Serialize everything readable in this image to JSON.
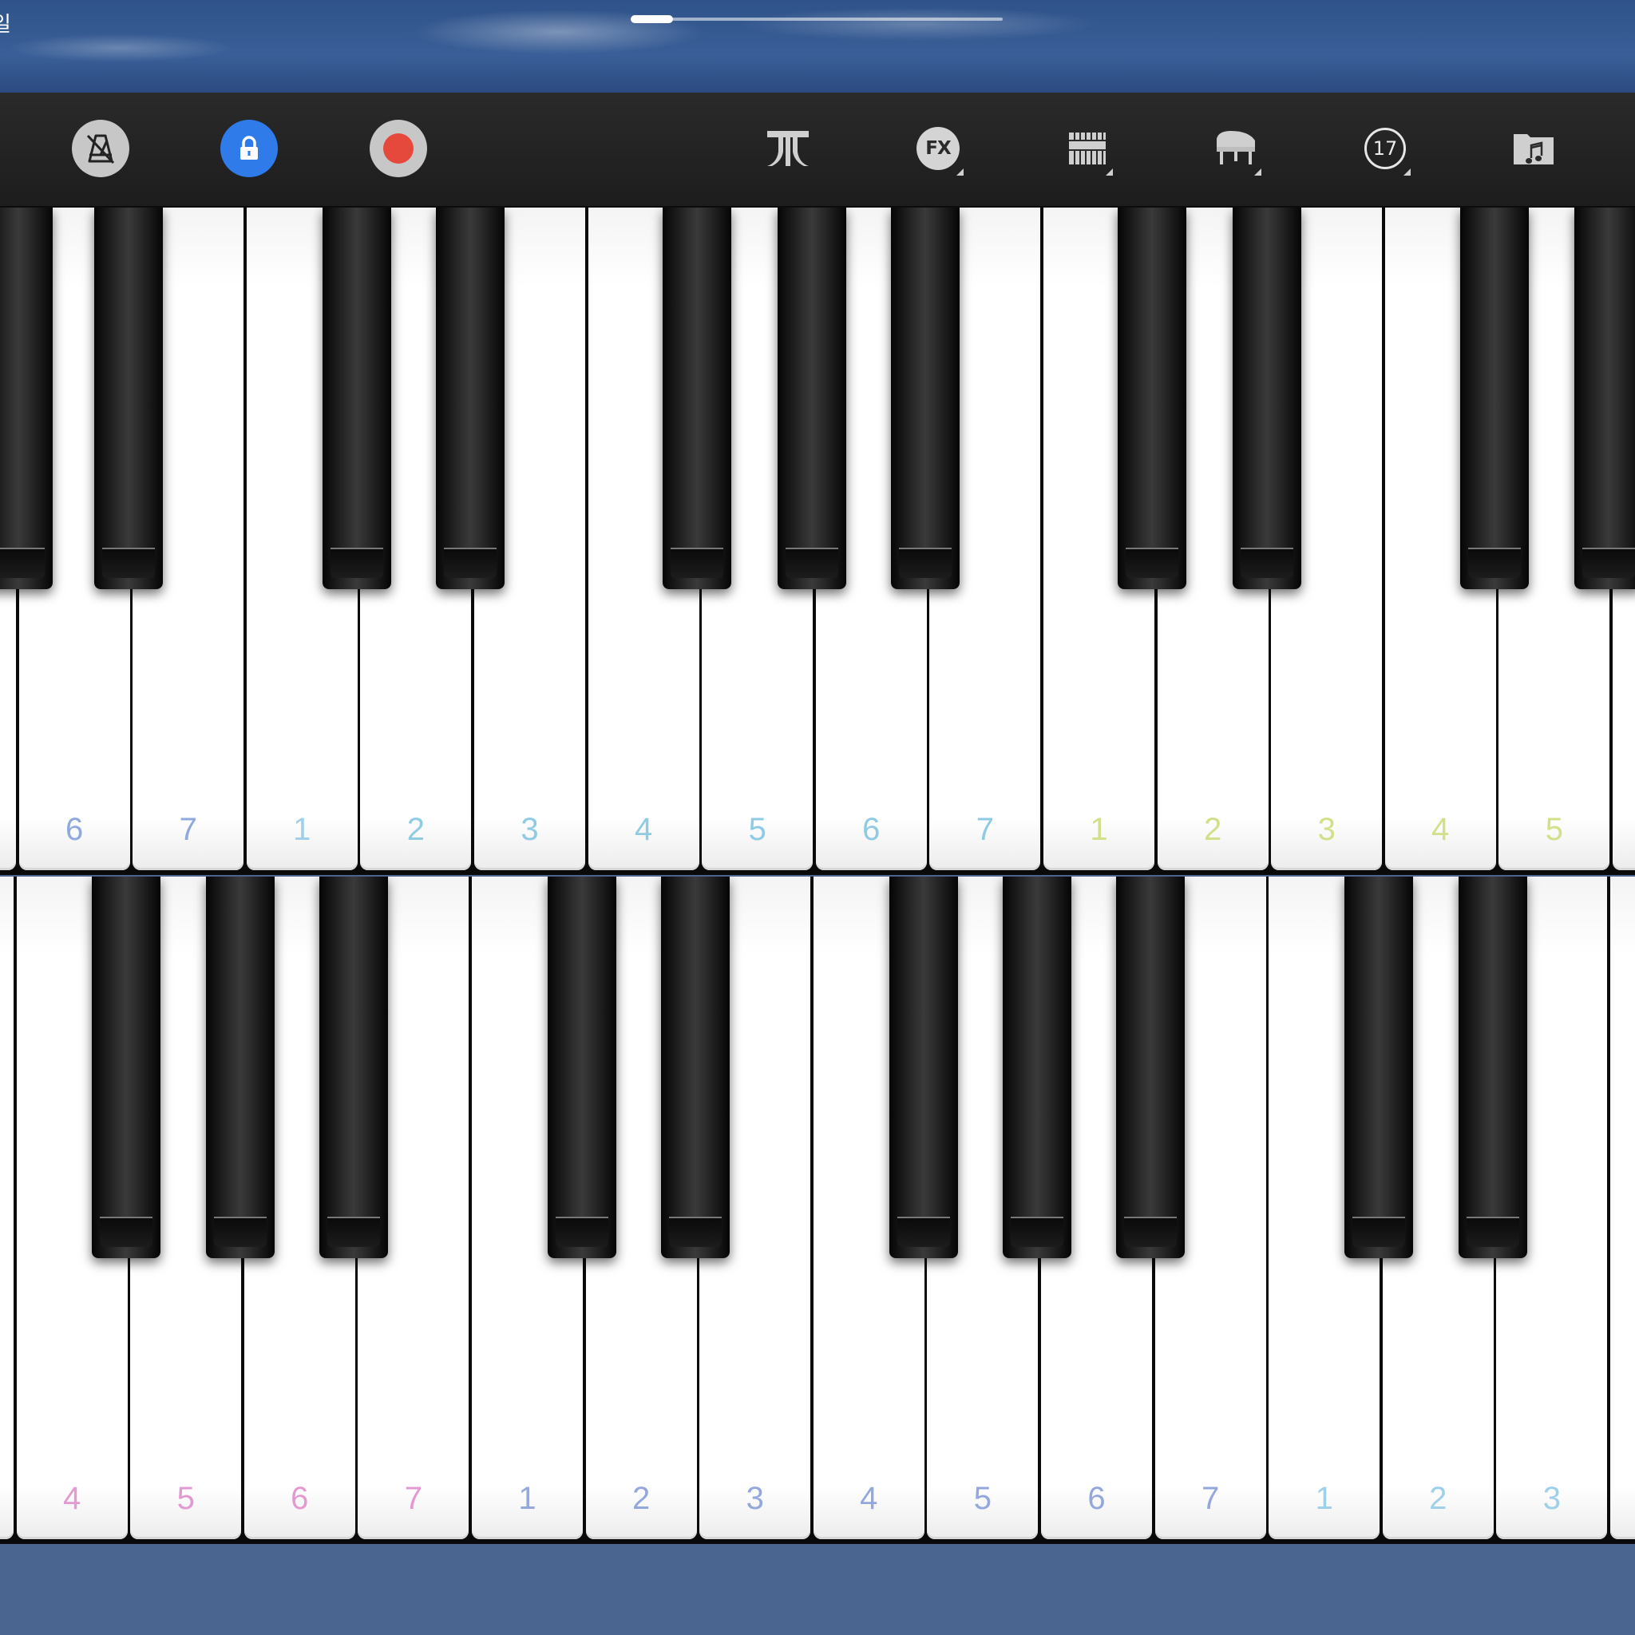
{
  "status": {
    "corner_text": "일",
    "scroll_position": 0.11
  },
  "toolbar": {
    "buttons": [
      {
        "name": "metronome-button",
        "icon": "metronome-off-icon"
      },
      {
        "name": "lock-button",
        "icon": "lock-icon",
        "active": true,
        "color": "#2f7bea"
      },
      {
        "name": "record-button",
        "icon": "record-icon",
        "color": "#e4493b"
      },
      {
        "name": "sustain-button",
        "icon": "sustain-pedal-icon"
      },
      {
        "name": "fx-button",
        "icon": "fx-icon",
        "label": "FX"
      },
      {
        "name": "keyboard-layout-button",
        "icon": "keyboard-icon"
      },
      {
        "name": "instrument-button",
        "icon": "grand-piano-icon"
      },
      {
        "name": "key-count-button",
        "icon": "number-circle-icon",
        "label": "17"
      },
      {
        "name": "songs-button",
        "icon": "music-folder-icon"
      }
    ]
  },
  "keyboards": {
    "upper": {
      "white_keys": [
        {
          "label": "",
          "color": "#9ab0e0"
        },
        {
          "label": "6",
          "color": "#8fa8de"
        },
        {
          "label": "7",
          "color": "#8fa8de"
        },
        {
          "label": "1",
          "color": "#9fd0ea"
        },
        {
          "label": "2",
          "color": "#8fcbe4"
        },
        {
          "label": "3",
          "color": "#8fcbe4"
        },
        {
          "label": "4",
          "color": "#8fcbe4"
        },
        {
          "label": "5",
          "color": "#8fcbe4"
        },
        {
          "label": "6",
          "color": "#8fcbe4"
        },
        {
          "label": "7",
          "color": "#8fcbe4"
        },
        {
          "label": "1",
          "color": "#d3e08a"
        },
        {
          "label": "2",
          "color": "#d3e08a"
        },
        {
          "label": "3",
          "color": "#d3e08a"
        },
        {
          "label": "4",
          "color": "#d3e08a"
        },
        {
          "label": "5",
          "color": "#d3e08a"
        },
        {
          "label": "",
          "color": "#d3e08a"
        }
      ]
    },
    "lower": {
      "white_keys": [
        {
          "label": "",
          "color": "#e39ad3"
        },
        {
          "label": "4",
          "color": "#e39ad3"
        },
        {
          "label": "5",
          "color": "#e39ad3"
        },
        {
          "label": "6",
          "color": "#e39ad3"
        },
        {
          "label": "7",
          "color": "#e39ad3"
        },
        {
          "label": "1",
          "color": "#95a8de"
        },
        {
          "label": "2",
          "color": "#95a8de"
        },
        {
          "label": "3",
          "color": "#95a8de"
        },
        {
          "label": "4",
          "color": "#95a8de"
        },
        {
          "label": "5",
          "color": "#95a8de"
        },
        {
          "label": "6",
          "color": "#95a8de"
        },
        {
          "label": "7",
          "color": "#95a8de"
        },
        {
          "label": "1",
          "color": "#9fd0ea"
        },
        {
          "label": "2",
          "color": "#9fd0ea"
        },
        {
          "label": "3",
          "color": "#9fd0ea"
        },
        {
          "label": "",
          "color": "#9fd0ea"
        }
      ]
    }
  }
}
